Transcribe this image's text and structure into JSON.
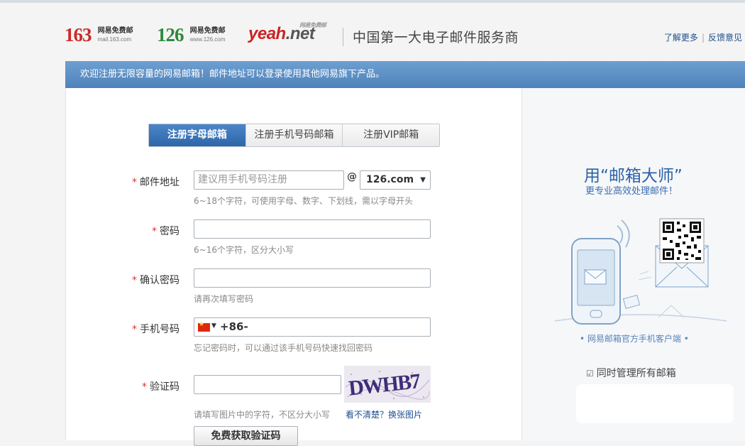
{
  "header": {
    "logos": [
      {
        "num": "163",
        "cn": "网易免费邮",
        "url": "mail.163.com",
        "color": "#cc2a2a"
      },
      {
        "num": "126",
        "cn": "网易免费邮",
        "url": "www.126.com",
        "color": "#2e8a3a"
      }
    ],
    "yeah": {
      "main": "yeah",
      "dot": ".",
      "net": "net",
      "tag": "网易免费邮"
    },
    "slogan": "中国第一大电子邮件服务商",
    "links": {
      "more": "了解更多",
      "separator": "|",
      "feedback": "反馈意见"
    }
  },
  "banner": {
    "text": "欢迎注册无限容量的网易邮箱！邮件地址可以登录使用其他网易旗下产品。"
  },
  "tabs": [
    {
      "label": "注册字母邮箱",
      "active": true
    },
    {
      "label": "注册手机号码邮箱",
      "active": false
    },
    {
      "label": "注册VIP邮箱",
      "active": false
    }
  ],
  "form": {
    "required_mark": "*",
    "email": {
      "label": "邮件地址",
      "placeholder": "建议用手机号码注册",
      "at": "@",
      "domain": "126.com",
      "hint": "6~18个字符，可使用字母、数字、下划线，需以字母开头"
    },
    "password": {
      "label": "密码",
      "hint": "6~16个字符，区分大小写"
    },
    "confirm": {
      "label": "确认密码",
      "hint": "请再次填写密码"
    },
    "phone": {
      "label": "手机号码",
      "code": "+86-",
      "hint": "忘记密码时，可以通过该手机号码快速找回密码"
    },
    "captcha": {
      "label": "验证码",
      "text": "DWHB7",
      "hint": "请填写图片中的字符，不区分大小写",
      "link": "看不清楚？换张图片"
    },
    "get_code_button": "免费获取验证码"
  },
  "sidebar": {
    "title": "用“邮箱大师”",
    "subtitle": "更专业高效处理邮件！",
    "client_note": "• 网易邮箱官方手机客户端 •",
    "feature": "同时管理所有邮箱"
  },
  "colors": {
    "accent": "#2e66a8",
    "brand_red": "#cc2a2a",
    "brand_green": "#2e8a3a",
    "required": "#dd3333"
  }
}
